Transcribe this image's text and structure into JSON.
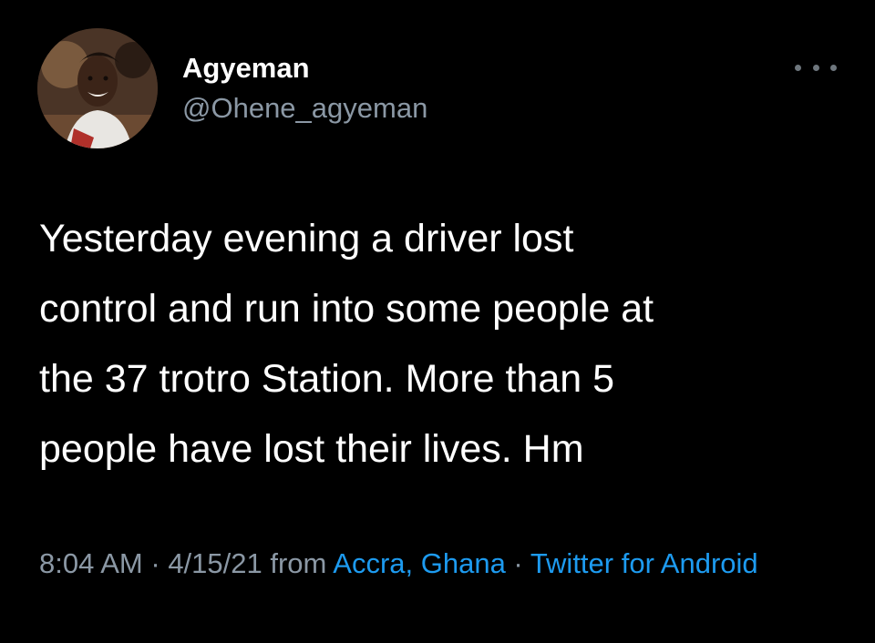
{
  "user": {
    "display_name": "Agyeman",
    "handle": "@Ohene_agyeman",
    "avatar_icon": "profile-photo"
  },
  "tweet": {
    "lines": [
      "Yesterday evening a driver lost",
      "control and run into some people at",
      "the 37 trotro Station. More than 5",
      "people have lost their lives. Hm"
    ]
  },
  "meta": {
    "time": "8:04 AM",
    "separator": " · ",
    "date": "4/15/21",
    "from_text": " from ",
    "location": "Accra, Ghana",
    "source": "Twitter for Android"
  },
  "colors": {
    "background": "#000000",
    "text": "#ffffff",
    "secondary": "#8b98a5",
    "link": "#1d9bf0"
  },
  "icons": {
    "more": "more-options-icon"
  }
}
